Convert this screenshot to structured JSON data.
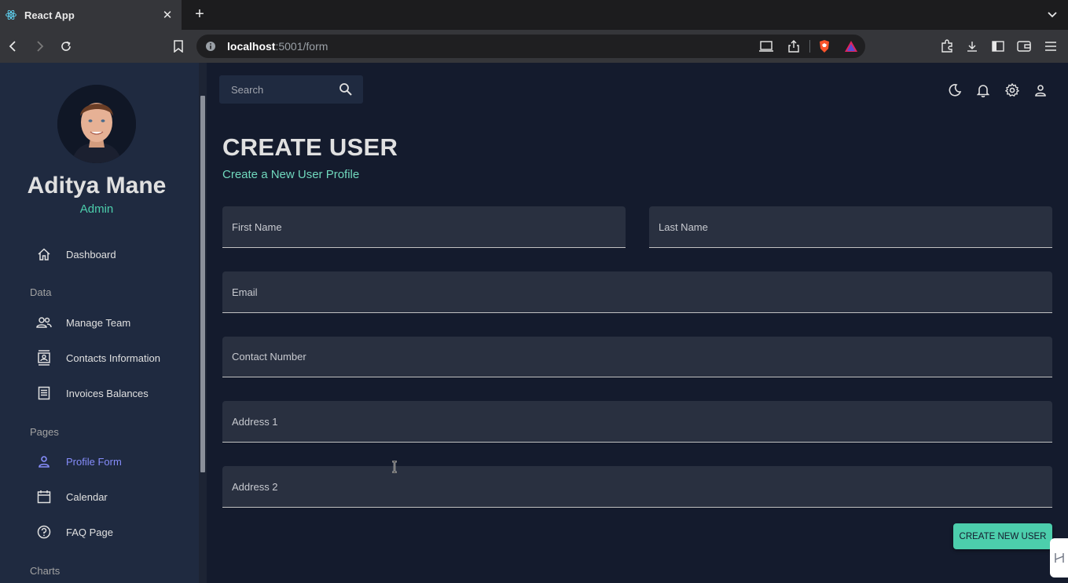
{
  "browser": {
    "tab_title": "React App",
    "url_host": "localhost",
    "url_path": ":5001/form"
  },
  "sidebar": {
    "user_name": "Aditya Mane",
    "user_role": "Admin",
    "items": [
      {
        "label": "Dashboard",
        "icon": "home-icon"
      },
      {
        "section": "Data"
      },
      {
        "label": "Manage Team",
        "icon": "people-icon"
      },
      {
        "label": "Contacts Information",
        "icon": "contacts-icon"
      },
      {
        "label": "Invoices Balances",
        "icon": "receipt-icon"
      },
      {
        "section": "Pages"
      },
      {
        "label": "Profile Form",
        "icon": "person-icon",
        "active": true
      },
      {
        "label": "Calendar",
        "icon": "calendar-icon"
      },
      {
        "label": "FAQ Page",
        "icon": "help-icon"
      },
      {
        "section": "Charts"
      }
    ]
  },
  "topbar": {
    "search_placeholder": "Search",
    "icons": [
      "dark-mode-icon",
      "notifications-icon",
      "settings-icon",
      "person-icon"
    ]
  },
  "form": {
    "title": "CREATE USER",
    "subtitle": "Create a New User Profile",
    "first_name_placeholder": "First Name",
    "last_name_placeholder": "Last Name",
    "email_placeholder": "Email",
    "contact_placeholder": "Contact Number",
    "address1_placeholder": "Address 1",
    "address2_placeholder": "Address 2",
    "submit_label": "CREATE NEW USER"
  },
  "colors": {
    "accent_green": "#4cceac",
    "subtitle_green": "#70d8bd",
    "active_blue": "#868dfb",
    "sidebar_bg": "#1f2a40",
    "main_bg": "#141b2d"
  }
}
